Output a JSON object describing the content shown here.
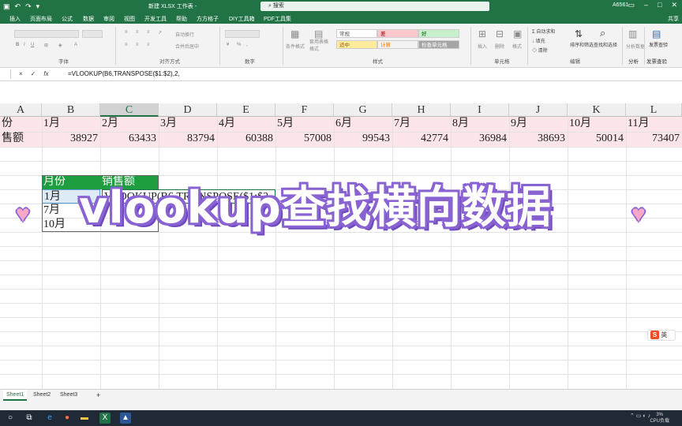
{
  "app": {
    "title": "新建 XLSX 工作表 -",
    "search_placeholder": "搜索",
    "user": "A6561",
    "share": "共享"
  },
  "ribbon_tabs": [
    "插入",
    "页面布局",
    "公式",
    "数据",
    "审阅",
    "视图",
    "开发工具",
    "帮助",
    "方方格子",
    "DIY工具箱",
    "PDF工具集"
  ],
  "ribbon_groups": {
    "font": "字体",
    "alignment": "对齐方式",
    "number": "数字",
    "styles": "样式",
    "cells": "单元格",
    "editing": "编辑",
    "analysis": "分析",
    "invoice": "发票查验"
  },
  "ribbon_controls": {
    "wrap_text": "自动换行",
    "merge_center": "合并后居中",
    "conditional_format": "条件格式",
    "format_as_table": "套用表格格式",
    "style_normal": "常规",
    "style_bad": "差",
    "style_good": "好",
    "style_neutral": "适中",
    "style_calc": "计算",
    "style_check": "检查单元格",
    "insert": "插入",
    "delete": "删除",
    "format": "格式",
    "autosum": "自动求和",
    "fill": "填充",
    "clear": "清除",
    "sort_filter": "排序和筛选",
    "find_select": "查找和选择",
    "analyze_data": "分析数据",
    "invoice_check": "发票查验"
  },
  "formula_bar": {
    "cancel": "×",
    "enter": "✓",
    "fx": "fx",
    "formula": "=VLOOKUP(B6,TRANSPOSE($1:$2),2,"
  },
  "columns": [
    "A",
    "B",
    "C",
    "D",
    "E",
    "F",
    "G",
    "H",
    "I",
    "J",
    "K",
    "L"
  ],
  "selected_column": "C",
  "row1": [
    "份",
    "1月",
    "2月",
    "3月",
    "4月",
    "5月",
    "6月",
    "7月",
    "8月",
    "9月",
    "10月",
    "11月"
  ],
  "row2_label": "售额",
  "row2_values": [
    "38927",
    "63433",
    "83794",
    "60388",
    "57008",
    "99543",
    "42774",
    "36984",
    "38693",
    "50014",
    "73407"
  ],
  "lookup_table": {
    "header_month": "月份",
    "header_sales": "销售额",
    "rows": [
      "1月",
      "7月",
      "10月"
    ]
  },
  "editing_cell_formula": "VLOOKUP(B6,TRANSPOSE($1:$2",
  "banner_text": "vlookup查找横向数据",
  "sheets": [
    "Sheet1",
    "Sheet2",
    "Sheet3"
  ],
  "active_sheet": "Sheet1",
  "add_sheet": "+",
  "ime": "英",
  "taskbar": {
    "cpu_percent": "3%",
    "cpu_label": "CPU负载"
  },
  "colors": {
    "excel_green": "#217346",
    "header_green": "#1e9e3e",
    "pink_row": "#fbe5e8",
    "banner_outline": "#8a63d2"
  }
}
